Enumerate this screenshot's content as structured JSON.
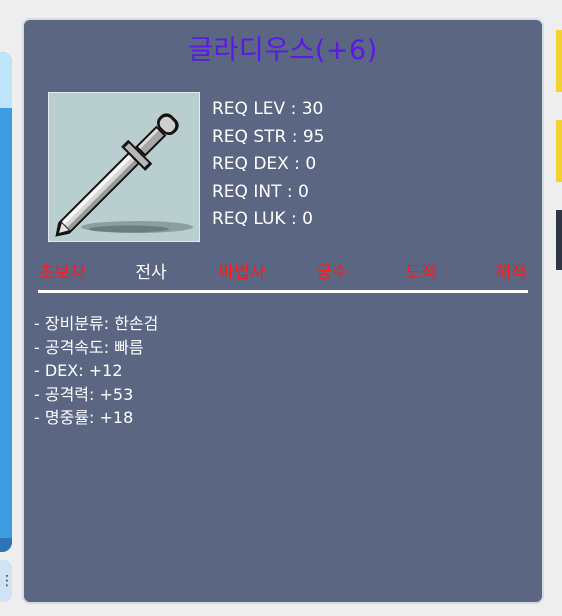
{
  "item": {
    "title": "글라디우스(+6)",
    "icon": "gladius-sword-icon"
  },
  "requirements": [
    "REQ LEV : 30",
    "REQ STR : 95",
    "REQ DEX : 0",
    "REQ INT : 0",
    "REQ LUK : 0"
  ],
  "jobs": [
    {
      "label": "초보자",
      "allowed": false
    },
    {
      "label": "전사",
      "allowed": true
    },
    {
      "label": "마법사",
      "allowed": false
    },
    {
      "label": "궁수",
      "allowed": false
    },
    {
      "label": "도적",
      "allowed": false
    },
    {
      "label": "해적",
      "allowed": false
    }
  ],
  "stats": [
    "- 장비분류: 한손검",
    "- 공격속도: 빠름",
    "- DEX: +12",
    "- 공격력: +53",
    "- 명중률: +18"
  ],
  "colors": {
    "panel": "#5a6682",
    "title": "#5b18e8",
    "job_disallowed": "#ff1a1a",
    "job_allowed": "#ffffff"
  }
}
